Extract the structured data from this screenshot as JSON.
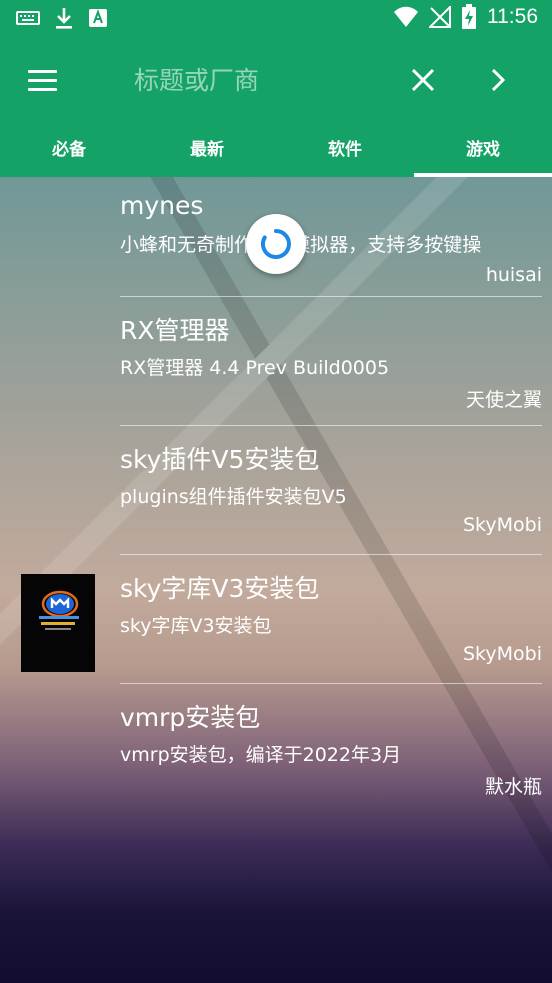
{
  "status_bar": {
    "left_icons": [
      "keyboard-icon",
      "download-icon",
      "text-app-icon"
    ],
    "right_icons": [
      "wifi-icon",
      "no-signal-icon",
      "battery-charging-icon"
    ],
    "time": "11:56"
  },
  "toolbar": {
    "search_placeholder": "标题或厂商",
    "search_value": "",
    "menu_icon": "menu-icon",
    "clear_icon": "close-icon",
    "next_icon": "chevron-right-icon"
  },
  "tabs": [
    {
      "label": "必备",
      "active": false
    },
    {
      "label": "最新",
      "active": false
    },
    {
      "label": "软件",
      "active": false
    },
    {
      "label": "游戏",
      "active": true
    }
  ],
  "items": [
    {
      "title": "mynes",
      "desc": "小蜂和无奇制作NES模拟器，支持多按键操",
      "author": "huisai",
      "has_thumb": false
    },
    {
      "title": "RX管理器",
      "desc": "RX管理器 4.4 Prev Build0005",
      "author": "天使之翼",
      "has_thumb": false
    },
    {
      "title": "sky插件V5安装包",
      "desc": "plugins组件插件安装包V5",
      "author": "SkyMobi",
      "has_thumb": false
    },
    {
      "title": "sky字库V3安装包",
      "desc": "sky字库V3安装包",
      "author": "SkyMobi",
      "has_thumb": true
    },
    {
      "title": "vmrp安装包",
      "desc": "vmrp安装包，编译于2022年3月",
      "author": "默水瓶",
      "has_thumb": false
    }
  ],
  "colors": {
    "primary": "#14a267",
    "on_primary": "#ffffff"
  }
}
